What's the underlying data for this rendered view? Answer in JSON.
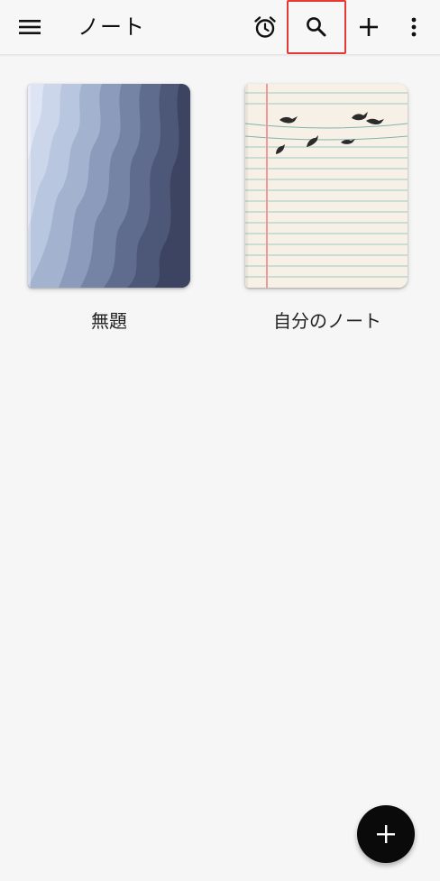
{
  "app_bar": {
    "title": "ノート",
    "menu_icon": "menu-icon",
    "actions": [
      {
        "icon": "alarm-icon"
      },
      {
        "icon": "search-icon",
        "highlighted": true
      },
      {
        "icon": "plus-icon"
      },
      {
        "icon": "more-vert-icon"
      }
    ]
  },
  "notebooks": [
    {
      "title": "無題",
      "cover": "wave-gradient"
    },
    {
      "title": "自分のノート",
      "cover": "lined-paper-birds"
    }
  ],
  "fab": {
    "icon": "plus-icon"
  },
  "colors": {
    "background": "#f6f6f6",
    "highlight": "#e53935",
    "fab": "#0a0a0a",
    "margin_line": "#ef9a9a",
    "paper": "#f7f0e6"
  }
}
